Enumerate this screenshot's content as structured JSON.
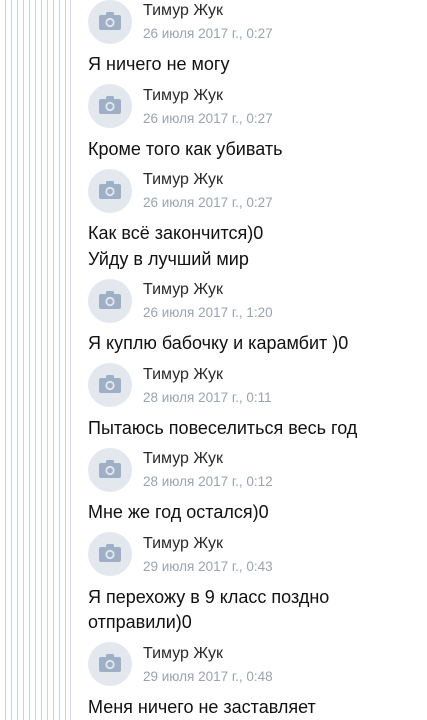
{
  "messages": [
    {
      "author": "Тимур Жук",
      "time": "26 июля 2017 г., 0:27",
      "lines": [
        "Я ничего не могу"
      ]
    },
    {
      "author": "Тимур Жук",
      "time": "26 июля 2017 г., 0:27",
      "lines": [
        "Кроме того как убивать"
      ]
    },
    {
      "author": "Тимур Жук",
      "time": "26 июля 2017 г., 0:27",
      "lines": [
        "Как всё закончится)0",
        "Уйду в лучший мир"
      ]
    },
    {
      "author": "Тимур Жук",
      "time": "26 июля 2017 г., 1:20",
      "lines": [
        "Я куплю бабочку и карамбит )0"
      ]
    },
    {
      "author": "Тимур Жук",
      "time": "28 июля 2017 г., 0:11",
      "lines": [
        "Пытаюсь повеселиться весь год"
      ]
    },
    {
      "author": "Тимур Жук",
      "time": "28 июля 2017 г., 0:12",
      "lines": [
        "Мне же год остался)0"
      ]
    },
    {
      "author": "Тимур Жук",
      "time": "29 июля 2017 г., 0:43",
      "lines": [
        "Я перехожу в 9 класс поздно",
        "отправили)0"
      ]
    },
    {
      "author": "Тимур Жук",
      "time": "29 июля 2017 г., 0:48",
      "lines": [
        "Меня ничего не заставляет"
      ]
    }
  ],
  "icons": {
    "avatar": "camera-icon"
  },
  "colors": {
    "avatar_bg": "#e3e8ef",
    "avatar_icon": "#9fb0c6",
    "timestamp": "#9aa3ae",
    "rules": "#c9d3e4"
  }
}
